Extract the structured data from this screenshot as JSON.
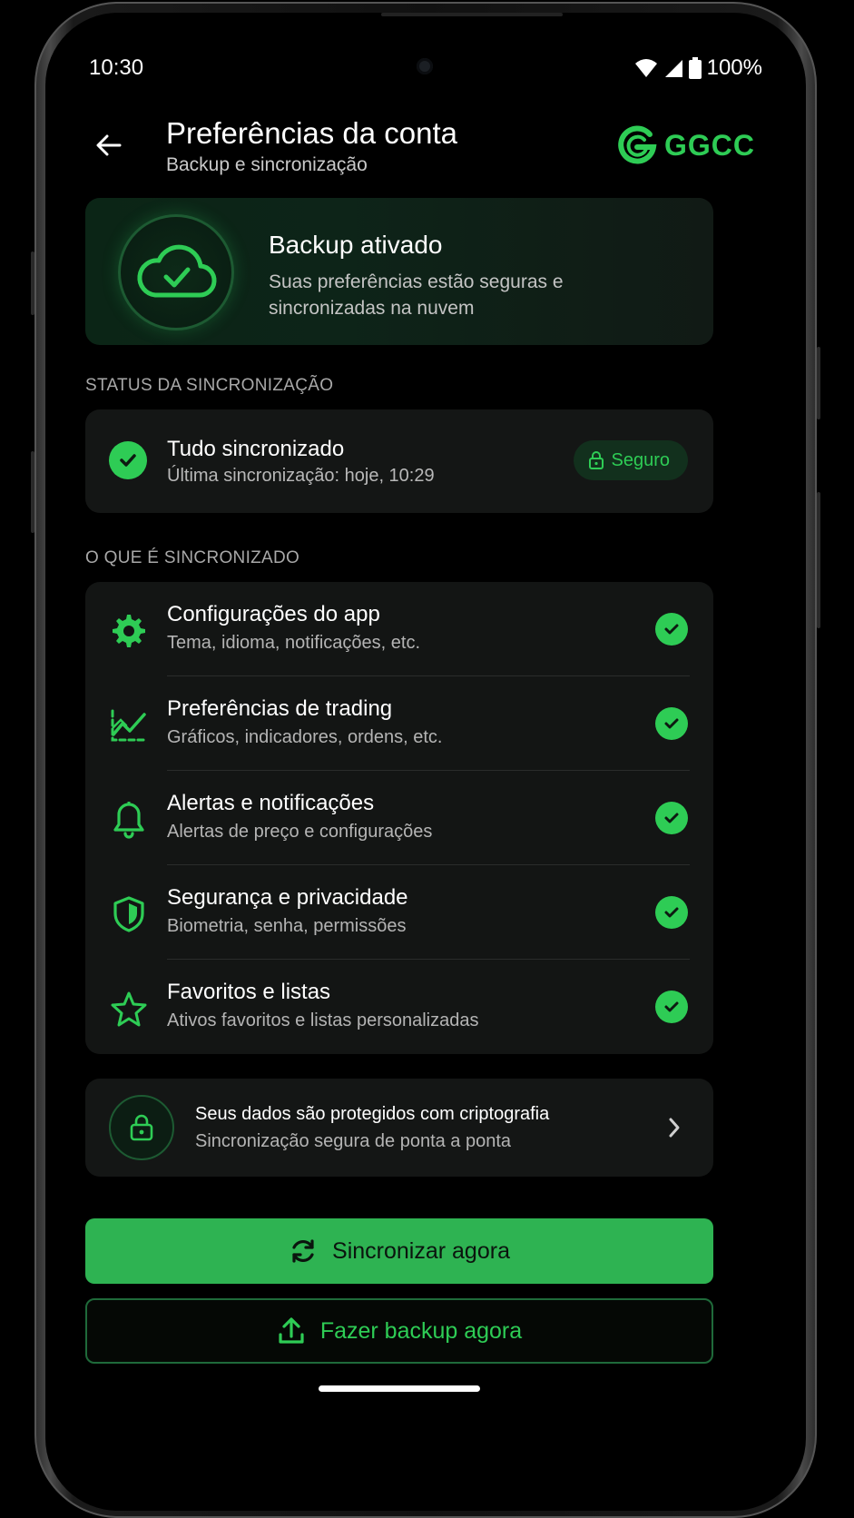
{
  "status_bar": {
    "time": "10:30",
    "battery": "100%"
  },
  "header": {
    "title": "Preferências da conta",
    "subtitle": "Backup e sincronização",
    "logo_text": "GGCC"
  },
  "hero": {
    "title": "Backup ativado",
    "description": "Suas preferências estão seguras e sincronizadas na nuvem",
    "icon": "cloud-check-icon"
  },
  "sync_status": {
    "section_label": "STATUS DA SINCRONIZAÇÃO",
    "title": "Tudo sincronizado",
    "subtitle": "Última sincronização: hoje, 10:29",
    "badge": "Seguro"
  },
  "synced_items": {
    "section_label": "O QUE É SINCRONIZADO",
    "items": [
      {
        "icon": "gear-icon",
        "title": "Configurações do app",
        "subtitle": "Tema, idioma, notificações, etc.",
        "synced": true
      },
      {
        "icon": "chart-icon",
        "title": "Preferências de trading",
        "subtitle": "Gráficos, indicadores, ordens, etc.",
        "synced": true
      },
      {
        "icon": "bell-icon",
        "title": "Alertas e notificações",
        "subtitle": "Alertas de preço e configurações",
        "synced": true
      },
      {
        "icon": "shield-icon",
        "title": "Segurança e privacidade",
        "subtitle": "Biometria, senha, permissões",
        "synced": true
      },
      {
        "icon": "star-icon",
        "title": "Favoritos e listas",
        "subtitle": "Ativos favoritos e listas personalizadas",
        "synced": true
      }
    ]
  },
  "encryption": {
    "title": "Seus dados são protegidos com criptografia",
    "subtitle": "Sincronização segura de ponta a ponta"
  },
  "actions": {
    "sync_now": "Sincronizar agora",
    "backup_now": "Fazer backup agora"
  },
  "colors": {
    "accent": "#2ecc55",
    "button": "#2eb352",
    "background": "#000000"
  }
}
